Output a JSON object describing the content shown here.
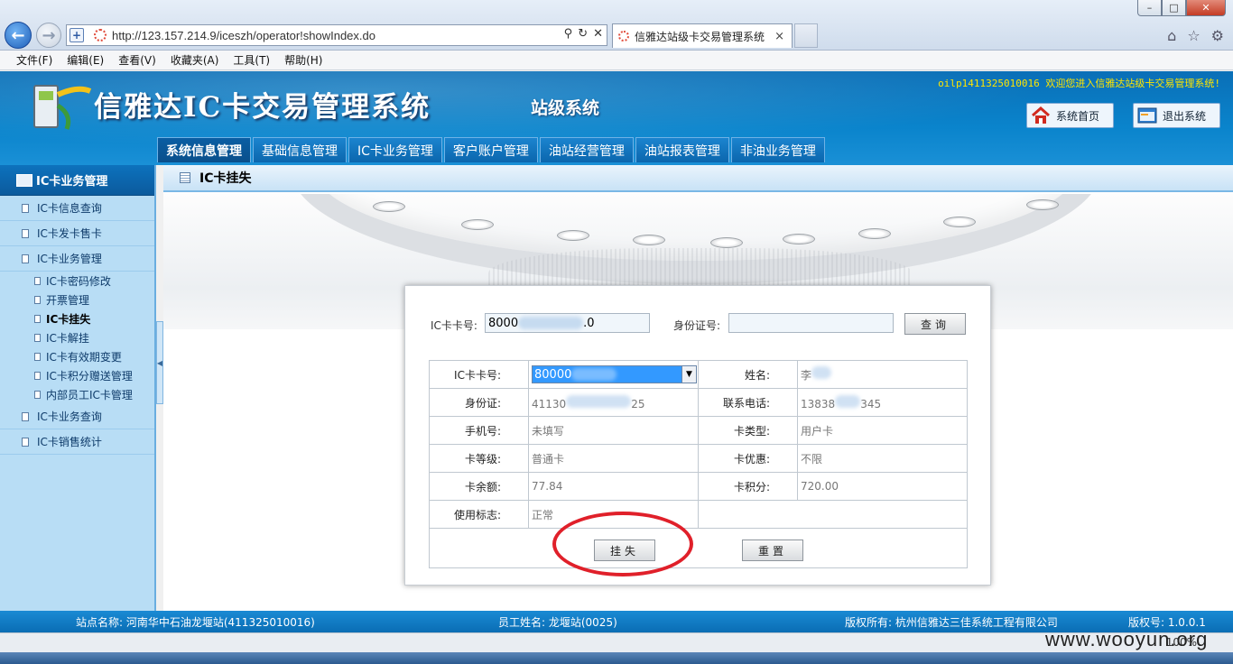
{
  "browser": {
    "url": "http://123.157.214.9/iceszh/operator!showIndex.do",
    "tab_title": "信雅达站级卡交易管理系统",
    "tab_close": "×",
    "menu": [
      "文件(F)",
      "编辑(E)",
      "查看(V)",
      "收藏夹(A)",
      "工具(T)",
      "帮助(H)"
    ],
    "zoom": "100%"
  },
  "header": {
    "title": "信雅达IC卡交易管理系统",
    "subtitle": "站级系统",
    "welcome": "oilp1411325010016 欢迎您进入信雅达站级卡交易管理系统!",
    "home_label": "系统首页",
    "exit_label": "退出系统",
    "nav": [
      "系统信息管理",
      "基础信息管理",
      "IC卡业务管理",
      "客户账户管理",
      "油站经营管理",
      "油站报表管理",
      "非油业务管理"
    ]
  },
  "sidebar": {
    "title": "IC卡业务管理",
    "items": [
      {
        "label": "IC卡信息查询"
      },
      {
        "label": "IC卡发卡售卡"
      },
      {
        "label": "IC卡业务管理"
      }
    ],
    "subitems": [
      "IC卡密码修改",
      "开票管理",
      "IC卡挂失",
      "IC卡解挂",
      "IC卡有效期变更",
      "IC卡积分赠送管理",
      "内部员工IC卡管理"
    ],
    "items_after": [
      {
        "label": "IC卡业务查询"
      },
      {
        "label": "IC卡销售统计"
      }
    ]
  },
  "content": {
    "title": "IC卡挂失",
    "search": {
      "card_label": "IC卡卡号:",
      "card_value_start": "8000",
      "card_value_end": ".0",
      "id_label": "身份证号:",
      "id_value": "",
      "query_label": "查询"
    },
    "info": {
      "card_no_label": "IC卡卡号:",
      "card_no_value": "80000",
      "name_label": "姓名:",
      "name_value": "李",
      "id_label": "身份证:",
      "id_value_start": "41130",
      "id_value_end": "25",
      "phone_label": "联系电话:",
      "phone_value_start": "13838",
      "phone_value_end": "345",
      "mobile_label": "手机号:",
      "mobile_value": "未填写",
      "card_type_label": "卡类型:",
      "card_type_value": "用户卡",
      "grade_label": "卡等级:",
      "grade_value": "普通卡",
      "discount_label": "卡优惠:",
      "discount_value": "不限",
      "balance_label": "卡余额:",
      "balance_value": "77.84",
      "points_label": "卡积分:",
      "points_value": "720.00",
      "status_label": "使用标志:",
      "status_value": "正常"
    },
    "lose_label": "挂失",
    "reset_label": "重置"
  },
  "footer": {
    "station": "站点名称: 河南华中石油龙堰站(411325010016)",
    "staff": "员工姓名: 龙堰站(0025)",
    "copyright": "版权所有: 杭州信雅达三佳系统工程有限公司",
    "version": "版权号: 1.0.0.1"
  },
  "watermark": "www.wooyun.org"
}
